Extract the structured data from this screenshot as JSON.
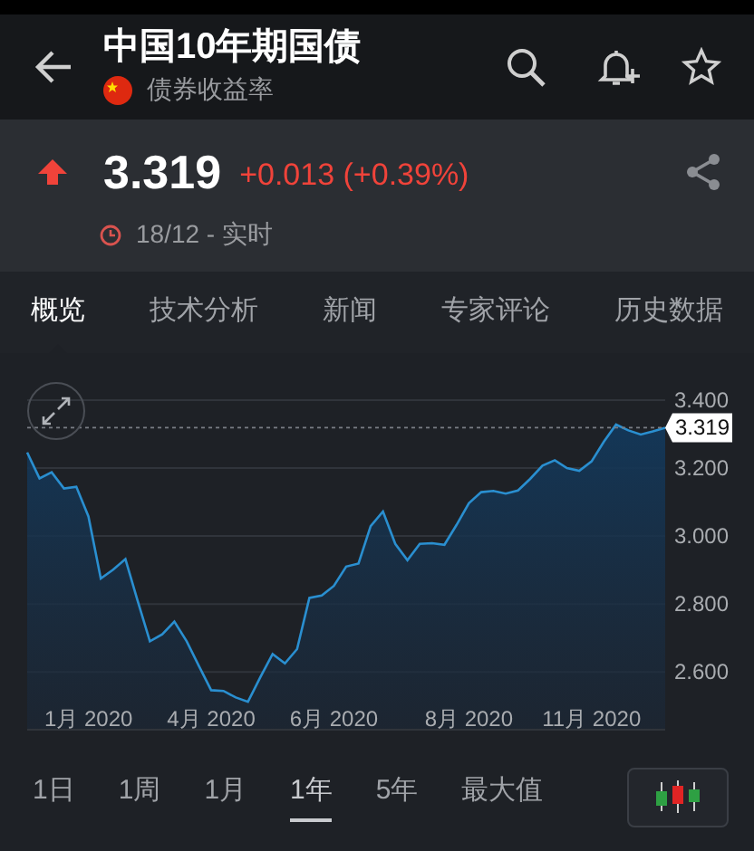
{
  "header": {
    "title": "中国10年期国债",
    "subtitle": "债券收益率"
  },
  "quote": {
    "price": "3.319",
    "change": "+0.013 (+0.39%)",
    "rising": true,
    "time": "18/12 - 实时"
  },
  "tabs": [
    {
      "label": "概览",
      "selected": true
    },
    {
      "label": "技术分析",
      "selected": false
    },
    {
      "label": "新闻",
      "selected": false
    },
    {
      "label": "专家评论",
      "selected": false
    },
    {
      "label": "历史数据",
      "selected": false
    }
  ],
  "chart": {
    "chart_data": {
      "type": "area",
      "categories": [
        null,
        null,
        null,
        null,
        null,
        "1月 2020",
        null,
        null,
        null,
        null,
        null,
        null,
        null,
        null,
        null,
        "4月 2020",
        null,
        null,
        null,
        null,
        null,
        null,
        null,
        null,
        null,
        "6月 2020",
        null,
        null,
        null,
        null,
        null,
        null,
        null,
        null,
        null,
        null,
        "8月 2020",
        null,
        null,
        null,
        null,
        null,
        null,
        null,
        null,
        null,
        "11月 2020",
        null,
        null,
        null,
        null,
        null,
        null
      ],
      "series": [
        {
          "color": "#2a8fd0",
          "values": [
            3.246,
            3.17,
            3.188,
            3.14,
            3.145,
            3.058,
            2.875,
            2.901,
            2.932,
            2.81,
            2.69,
            2.711,
            2.748,
            2.69,
            2.617,
            2.546,
            2.544,
            2.525,
            2.512,
            2.584,
            2.653,
            2.625,
            2.667,
            2.818,
            2.825,
            2.853,
            2.91,
            2.919,
            3.029,
            3.072,
            2.977,
            2.929,
            2.977,
            2.979,
            2.974,
            3.033,
            3.097,
            3.129,
            3.133,
            3.125,
            3.134,
            3.168,
            3.207,
            3.223,
            3.2,
            3.192,
            3.22,
            3.278,
            3.328,
            3.311,
            3.299,
            3.308,
            3.319
          ]
        }
      ],
      "grid": true,
      "ylim": [
        2.43,
        3.4
      ],
      "ref_lines": [
        {
          "axis": "y",
          "value": 3.319
        }
      ],
      "yticks": [
        {
          "value": 2.6,
          "label": "2.600"
        },
        {
          "value": 2.8,
          "label": "2.800"
        },
        {
          "value": 3.0,
          "label": "3.000"
        },
        {
          "value": 3.2,
          "label": "3.200"
        },
        {
          "value": 3.4,
          "label": "3.400"
        }
      ],
      "annotations": [
        "3.319"
      ]
    }
  },
  "ranges": [
    {
      "label": "1日",
      "selected": false
    },
    {
      "label": "1周",
      "selected": false
    },
    {
      "label": "1月",
      "selected": false
    },
    {
      "label": "1年",
      "selected": true
    },
    {
      "label": "5年",
      "selected": false
    },
    {
      "label": "最大值",
      "selected": false
    }
  ]
}
